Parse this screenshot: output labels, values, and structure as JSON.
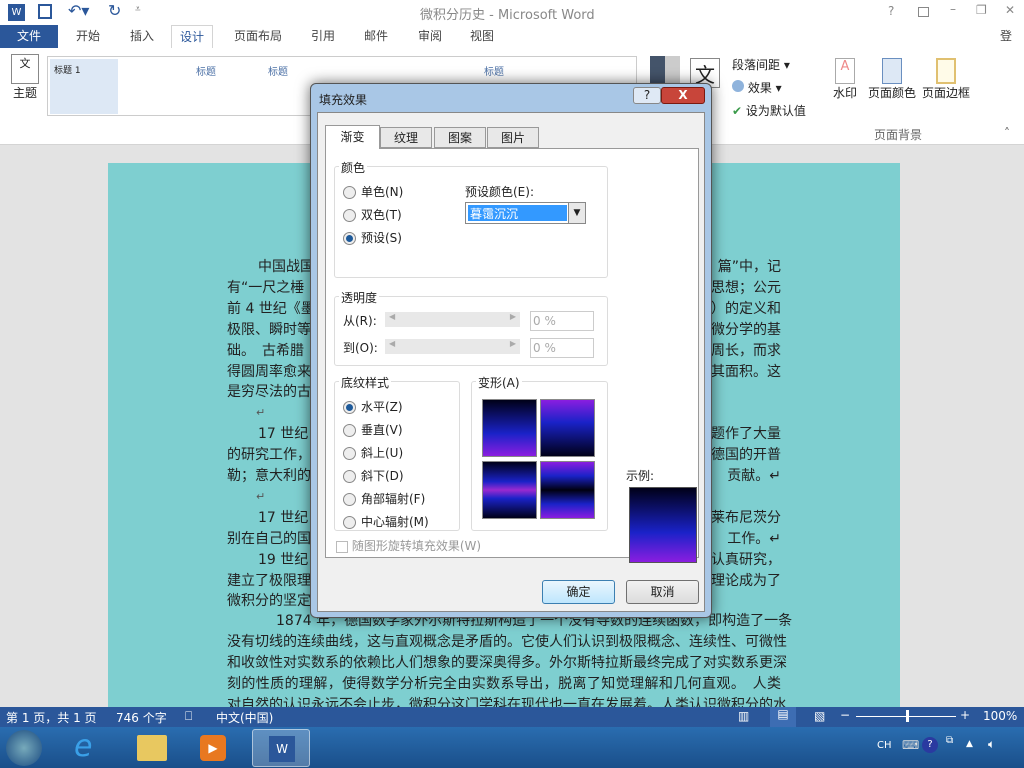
{
  "window": {
    "title": "微积分历史 - Microsoft Word",
    "help": "?",
    "login": "登录"
  },
  "tabs": [
    "文件",
    "开始",
    "插入",
    "设计",
    "页面布局",
    "引用",
    "邮件",
    "审阅",
    "视图"
  ],
  "ribbon": {
    "theme": "主题",
    "para_spacing": "段落间距",
    "effects": "效果",
    "set_default": "设为默认值",
    "watermark": "水印",
    "page_color": "页面颜色",
    "page_border": "页面边框",
    "group_page_bg": "页面背景",
    "gallery_title": "标题",
    "gallery_heading1": "标题 1"
  },
  "document": {
    "lines": [
      {
        "l": "中国战国",
        "r": "篇”中，记",
        "indent": true
      },
      {
        "l": "有“一尺之棰",
        "r": "思想；公元"
      },
      {
        "l": "前 4 世纪《墨",
        "r": "）的定义和"
      },
      {
        "l": "极限、瞬时等",
        "r": "微分学的基"
      },
      {
        "l": "础。　古希腊",
        "r": "周长，而求"
      },
      {
        "l": "得圆周率愈来",
        "r": "其面积。这"
      },
      {
        "l": "是穷尽法的古",
        "r": ""
      },
      {
        "l": "↵",
        "r": "",
        "mark": true
      },
      {
        "l": "17 世纪",
        "r": "题作了大量",
        "indent": true
      },
      {
        "l": "的研究工作，",
        "r": "德国的开普"
      },
      {
        "l": "勒；意大利的",
        "r": "贡献。↵"
      },
      {
        "l": "↵",
        "r": "",
        "mark": true
      },
      {
        "l": "17 世纪",
        "r": "莱布尼茨分",
        "indent": true
      },
      {
        "l": "别在自己的国",
        "r": "工作。↵"
      },
      {
        "l": "19 世纪",
        "r": "认真研究，",
        "indent": true
      },
      {
        "l": "建立了极限理",
        "r": "理论成为了"
      },
      {
        "l": "微积分的坚定",
        "r": ""
      }
    ],
    "full_lines": [
      "1874 年，德国数学家外尔斯特拉斯构造了一个没有导数的连续函数，即构造了一条",
      "没有切线的连续曲线，这与直观概念是矛盾的。它使人们认识到极限概念、连续性、可微性",
      "和收敛性对实数系的依赖比人们想象的要深奥得多。外尔斯特拉斯最终完成了对实数系更深",
      "刻的性质的理解，使得数学分析完全由实数系导出，脱离了知觉理解和几何直观。　人类",
      "对自然的认识永远不会止步，微积分这门学科在现代也一直在发展着。人类认识微积分的水"
    ]
  },
  "dialog": {
    "title": "填充效果",
    "help": "?",
    "close": "X",
    "tabs": [
      "渐变",
      "纹理",
      "图案",
      "图片"
    ],
    "color_group": "颜色",
    "radio_single": "单色(N)",
    "radio_two": "双色(T)",
    "radio_preset": "预设(S)",
    "preset_label": "预设颜色(E):",
    "preset_value": "暮霭沉沉",
    "transparency_group": "透明度",
    "from_label": "从(R):",
    "to_label": "到(O):",
    "from_value": "0 %",
    "to_value": "0 %",
    "shading_group": "底纹样式",
    "shading": [
      "水平(Z)",
      "垂直(V)",
      "斜上(U)",
      "斜下(D)",
      "角部辐射(F)",
      "中心辐射(M)"
    ],
    "variants_label": "变形(A)",
    "sample_label": "示例:",
    "rotate_checkbox": "随图形旋转填充效果(W)",
    "ok": "确定",
    "cancel": "取消"
  },
  "status": {
    "page": "第 1 页，共 1 页",
    "words": "746 个字",
    "lang": "中文(中国)",
    "zoom": "100%",
    "zoom_percent": 100
  },
  "tray": {
    "ime": "CH"
  },
  "colors": {
    "accent": "#2b579a",
    "page_bg": "#7ecfd0",
    "selection": "#3399ff"
  }
}
